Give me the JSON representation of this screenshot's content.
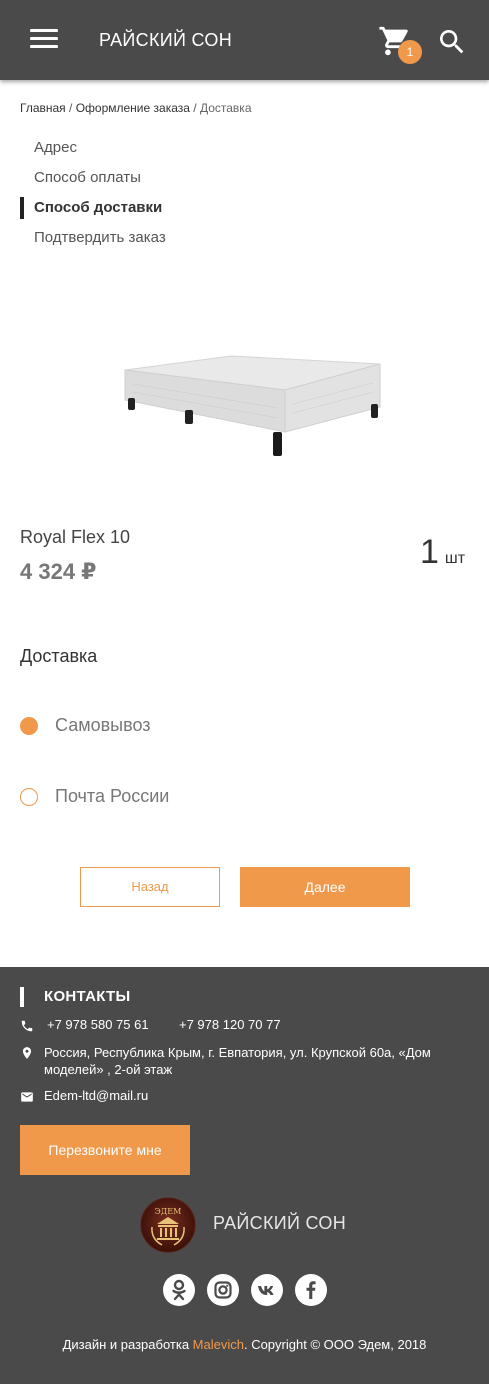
{
  "colors": {
    "header_bg": "#4a4a4a",
    "accent": "#f0994a",
    "footer_bg": "#4a4a4a"
  },
  "header": {
    "menu_icon": "hamburger-menu-icon",
    "brand": "РАЙСКИЙ СОН",
    "cart_icon": "cart-icon",
    "cart_count": "1",
    "search_icon": "search-icon"
  },
  "breadcrumb": {
    "items": [
      "Главная",
      "Оформление заказа",
      "Доставка"
    ],
    "separator": "/"
  },
  "steps": [
    "Адрес",
    "Способ оплаты",
    "Способ доставки",
    "Подтвердить заказ"
  ],
  "product": {
    "name": "Royal Flex 10",
    "price": "4 324 ₽",
    "quantity": "1",
    "unit": "шт"
  },
  "delivery": {
    "title": "Доставка",
    "options": [
      {
        "label": "Самовывоз",
        "selected": true
      },
      {
        "label": "Почта России",
        "selected": false
      }
    ]
  },
  "buttons": {
    "back": "Назад",
    "next": "Далее"
  },
  "footer": {
    "contacts_title": "КОНТАКТЫ",
    "phone_icon": "phone-icon",
    "phone1": "+7 978 580 75 61",
    "phone2": "+7 978 120 70 77",
    "location_icon": "location-pin-icon",
    "address": "Россия, Республика Крым, г. Евпатория, ул. Крупской 60а, «Дом моделей» , 2-ой этаж",
    "mail_icon": "mail-icon",
    "email": "Edem-ltd@mail.ru",
    "callback_button": "Перезвоните мне",
    "logo_text": "РАЙСКИЙ СОН",
    "logo_lettering": "ЭДЕМ",
    "social_icons": [
      "odnoklassniki-icon",
      "instagram-icon",
      "vk-icon",
      "facebook-icon"
    ],
    "copyright_prefix": "Дизайн и разработка ",
    "copyright_accent": "Malevich",
    "copyright_suffix": ". Copyright © ООО Эдем, 2018"
  }
}
